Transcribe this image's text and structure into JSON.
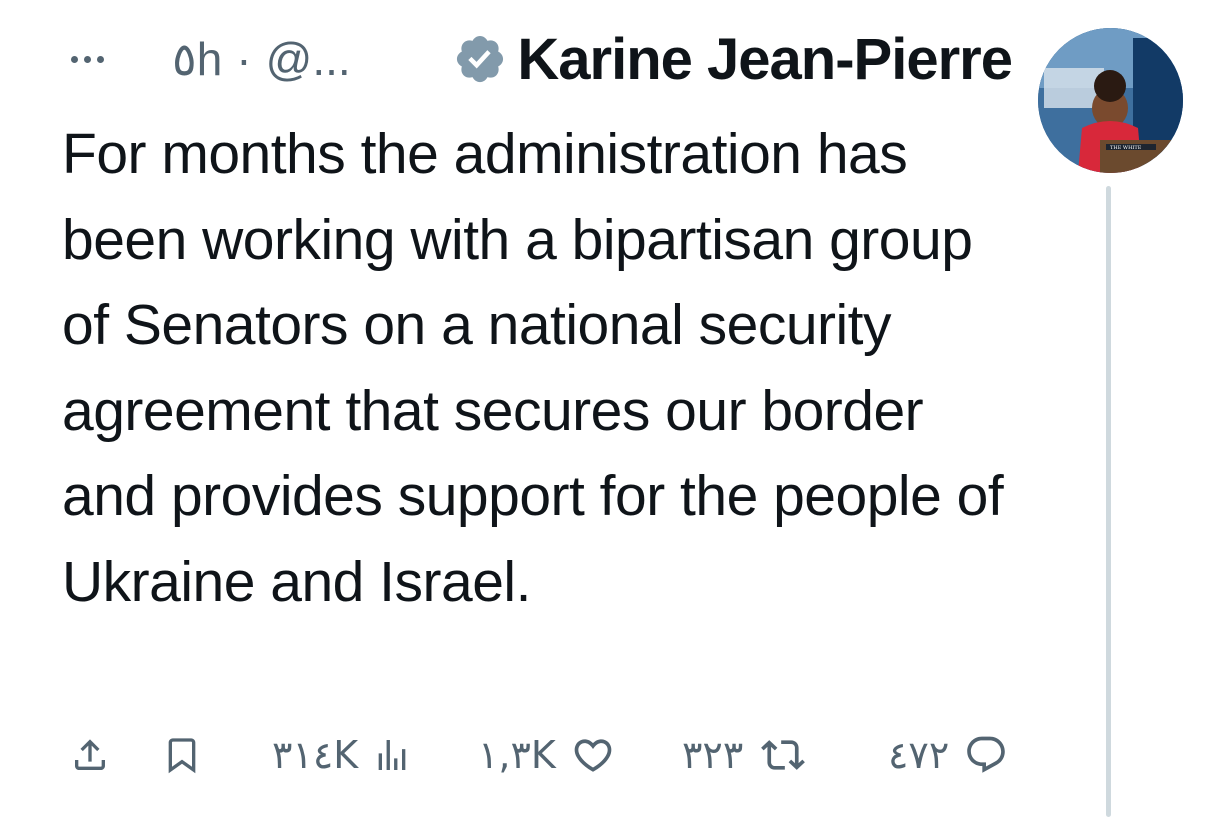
{
  "header": {
    "more_label": "···",
    "time": "٥h",
    "separator": "·",
    "handle": "@...",
    "author_name": "Karine Jean-Pierre"
  },
  "avatar": {
    "podium_text": "THE WHITE"
  },
  "tweet": {
    "text": "For months the administration has been working with a bipartisan group of Senators on a national security agreement that secures our border and provides support for the people of Ukraine and Israel."
  },
  "actions": {
    "views": "٣١٤K",
    "likes": "١,٣K",
    "retweets": "٣٢٣",
    "replies": "٤٧٢"
  },
  "colors": {
    "text": "#0f1419",
    "muted": "#536471",
    "verified": "#829aab",
    "thread_line": "#cfd9de"
  },
  "icons": [
    "more-icon",
    "verified-icon",
    "share-icon",
    "bookmark-icon",
    "views-icon",
    "like-icon",
    "retweet-icon",
    "reply-icon"
  ]
}
